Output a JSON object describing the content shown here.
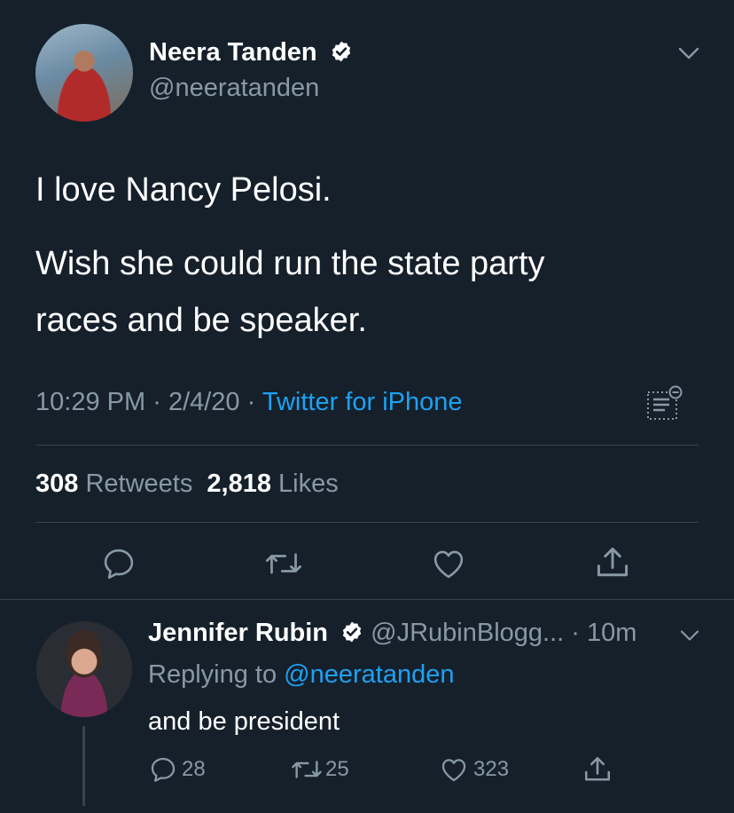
{
  "tweet": {
    "author_name": "Neera Tanden",
    "author_handle": "@neeratanden",
    "text_line1": "I love Nancy Pelosi.",
    "text_line2a": "Wish she could run the state party",
    "text_line2b": "races and be speaker.",
    "time": "10:29 PM",
    "date": "2/4/20",
    "separator": "·",
    "source": "Twitter for iPhone",
    "retweets_count": "308",
    "retweets_label": "Retweets",
    "likes_count": "2,818",
    "likes_label": "Likes"
  },
  "reply": {
    "author_name": "Jennifer Rubin",
    "author_handle": "@JRubinBlogg...",
    "time_ago": "· 10m",
    "replying_prefix": "Replying to",
    "replying_to": "@neeratanden",
    "text": "and be president",
    "replies": "28",
    "retweets": "25",
    "likes": "323"
  },
  "icons": {
    "verified": "verified-badge-icon",
    "chevron": "chevron-down-icon",
    "analytics": "analytics-icon",
    "reply": "reply-icon",
    "retweet": "retweet-icon",
    "like": "heart-icon",
    "share": "share-icon"
  },
  "colors": {
    "background": "#15202b",
    "accent": "#1da1f2",
    "muted": "#8899a6",
    "divider": "#38444d"
  }
}
